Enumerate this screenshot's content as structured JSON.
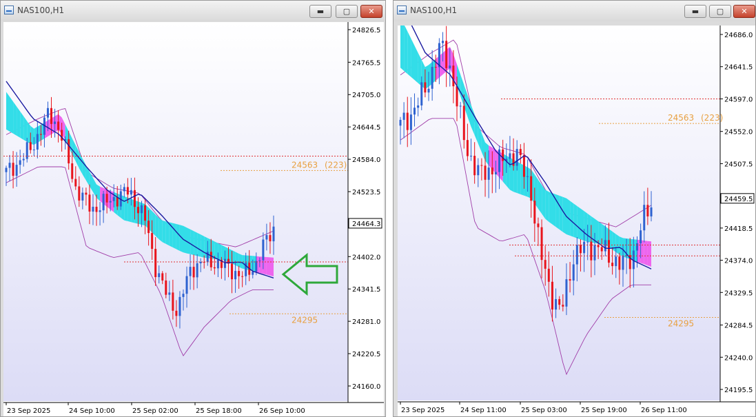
{
  "windows": [
    {
      "title": "NAS100,H1",
      "buttons": {
        "minimize": "▬",
        "maximize": "▢",
        "close": "✕"
      },
      "price_labels": [
        "24826.5",
        "24765.5",
        "24705.0",
        "24644.5",
        "24584.0",
        "24523.5",
        "24464.3",
        "24402.0",
        "24341.5",
        "24281.0",
        "24220.5",
        "24160.0"
      ],
      "current_price": "24464.3",
      "time_labels": [
        "23 Sep 2025",
        "24 Sep 10:00",
        "25 Sep 02:00",
        "25 Sep 18:00",
        "26 Sep 10:00"
      ],
      "levels": {
        "upper_value": "24563",
        "upper_pips": "(223)",
        "lower_value": "24295"
      }
    },
    {
      "title": "NAS100,H1",
      "buttons": {
        "minimize": "▬",
        "maximize": "▢",
        "close": "✕"
      },
      "price_labels": [
        "24686.0",
        "24641.5",
        "24597.0",
        "24552.0",
        "24507.5",
        "24459.5",
        "24418.5",
        "24374.0",
        "24329.5",
        "24284.5",
        "24240.0",
        "24195.5"
      ],
      "current_price": "24459.5",
      "time_labels": [
        "23 Sep 2025",
        "24 Sep 11:00",
        "25 Sep 03:00",
        "25 Sep 19:00",
        "26 Sep 11:00"
      ],
      "levels": {
        "upper_value": "24563",
        "upper_pips": "(223)",
        "lower_value": "24295"
      }
    }
  ],
  "colors": {
    "bull": "#2e62d0",
    "bear": "#e8141c",
    "cloud_up": "#33dde8",
    "cloud_down": "#ee66ee",
    "ma": "#1a1aa0",
    "envelope": "#a03ca8",
    "level": "#e8a040",
    "dash_red": "#e03030",
    "arrow": "#2ea83a",
    "bg_top": "#ffffff",
    "bg_bottom": "#dcdcf6"
  }
}
